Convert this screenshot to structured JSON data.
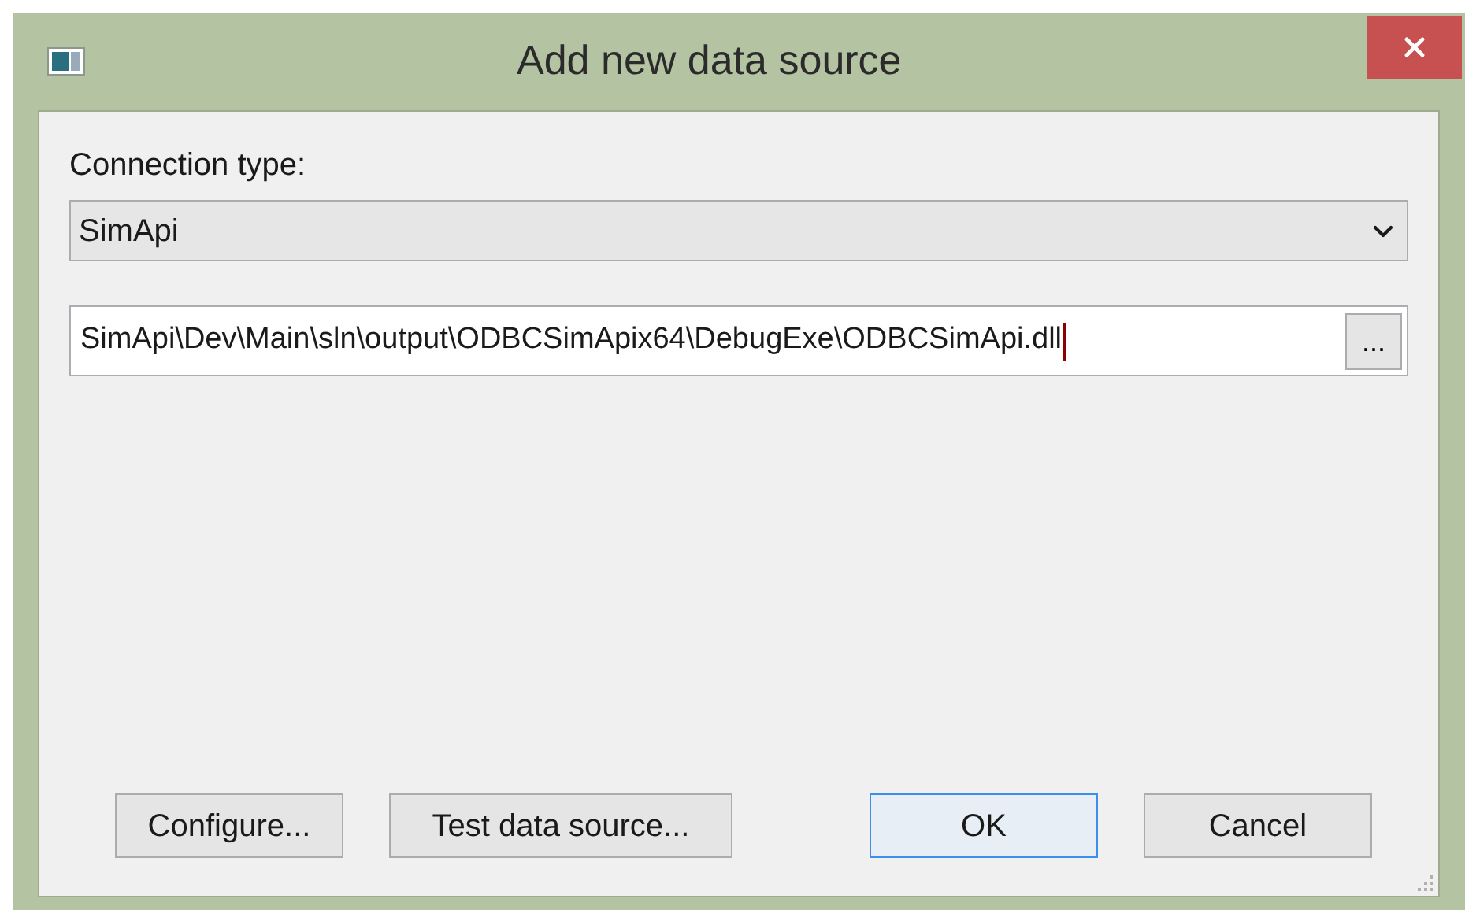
{
  "window": {
    "title": "Add new data source"
  },
  "connection_type": {
    "label": "Connection type:",
    "value": "SimApi"
  },
  "path_field": {
    "value": "SimApi\\Dev\\Main\\sln\\output\\ODBCSimApix64\\DebugExe\\ODBCSimApi.dll",
    "focused": true,
    "browse_label": "..."
  },
  "buttons": [
    {
      "label": "Configure...",
      "default": false
    },
    {
      "label": "Test data source...",
      "default": false
    },
    {
      "label": "OK",
      "default": true
    },
    {
      "label": "Cancel",
      "default": false
    }
  ]
}
